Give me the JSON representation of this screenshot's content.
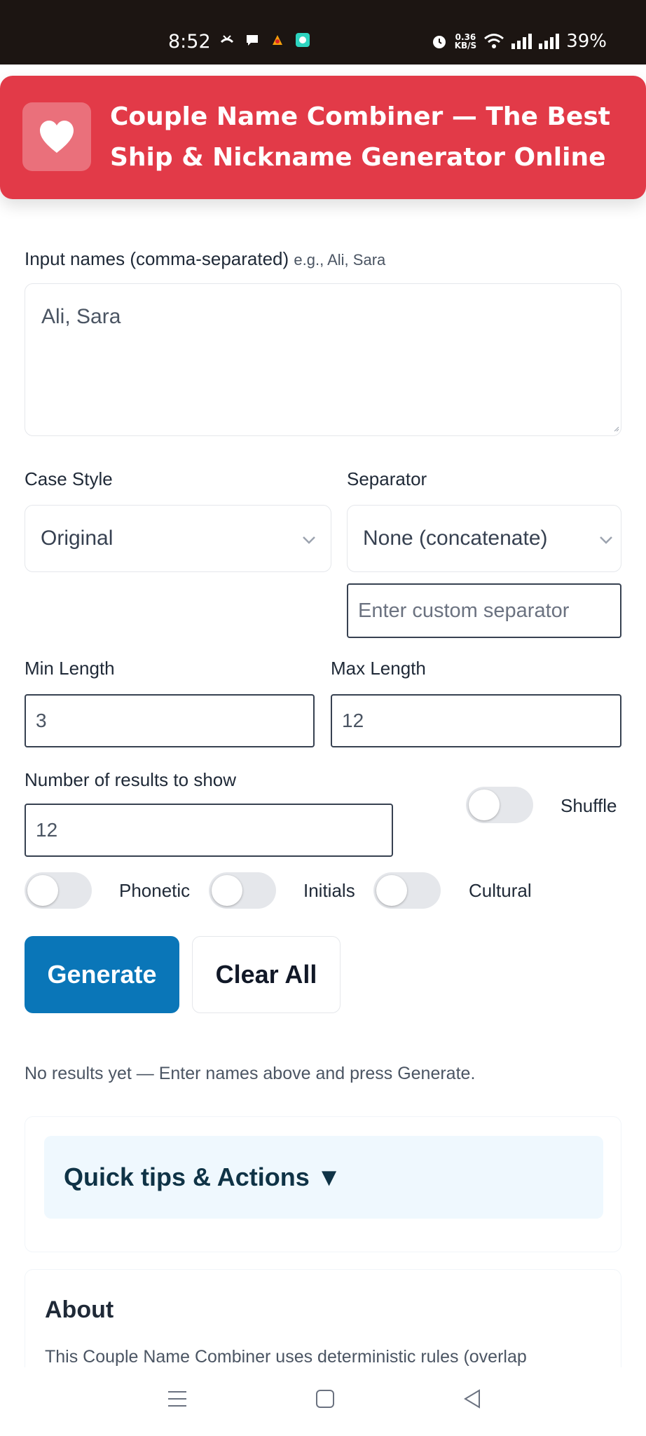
{
  "status_bar": {
    "time": "8:52",
    "speed_value": "0.36",
    "speed_unit": "KB/S",
    "battery": "39%"
  },
  "header": {
    "title": "Couple Name Combiner — The Best Ship & Nickname Generator Online",
    "logo_icon": "heart-icon"
  },
  "form": {
    "names_label": "Input names (comma-separated)",
    "names_hint": "e.g., Ali, Sara",
    "names_value": "Ali, Sara",
    "case_label": "Case Style",
    "case_value": "Original",
    "separator_label": "Separator",
    "separator_value": "None (concatenate)",
    "custom_separator_placeholder": "Enter custom separator",
    "min_label": "Min Length",
    "min_value": "3",
    "max_label": "Max Length",
    "max_value": "12",
    "count_label": "Number of results to show",
    "count_value": "12",
    "shuffle_label": "Shuffle",
    "phonetic_label": "Phonetic",
    "initials_label": "Initials",
    "cultural_label": "Cultural"
  },
  "actions": {
    "generate": "Generate",
    "clear": "Clear All"
  },
  "results": {
    "empty": "No results yet — Enter names above and press Generate."
  },
  "tips": {
    "title": "Quick tips & Actions ▼"
  },
  "about": {
    "title": "About",
    "text": "This Couple Name Combiner uses deterministic rules (overlap"
  },
  "colors": {
    "header_bg": "#e23a48",
    "primary": "#0a76b8",
    "tips_bg": "#eff8fe"
  }
}
